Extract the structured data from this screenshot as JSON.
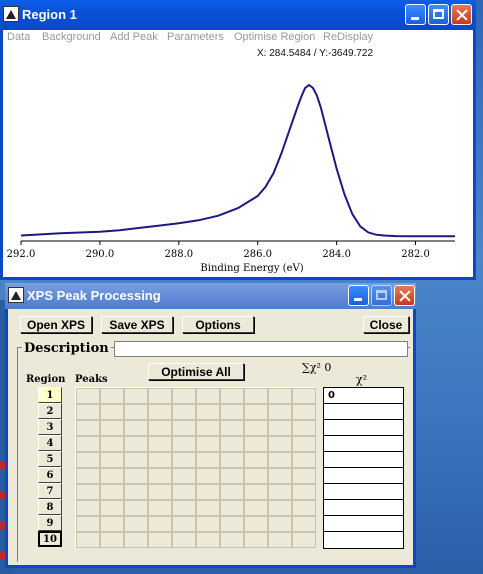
{
  "region_window": {
    "title": "Region 1",
    "menu": [
      "Data",
      "Background",
      "Add Peak",
      "Parameters",
      "Optimise Region",
      "ReDisplay"
    ],
    "coord_readout": "X: 284.5484 / Y:-3649.722",
    "icons": [
      "app-icon",
      "minimize-icon",
      "maximize-icon",
      "close-icon"
    ]
  },
  "chart_data": {
    "type": "line",
    "xlabel": "Binding Energy (eV)",
    "ylabel": "",
    "x_ticks": [
      "292.0",
      "290.0",
      "288.0",
      "286.0",
      "284.0",
      "282.0"
    ],
    "x_reversed": true,
    "xlim": [
      292.0,
      281.0
    ],
    "ylim": [
      0,
      1
    ],
    "line_color": "#1a1a80",
    "series": [
      {
        "x": [
          292.0,
          291.0,
          290.0,
          289.5,
          289.0,
          288.5,
          288.0,
          287.5,
          287.0,
          286.5,
          286.0,
          285.8,
          285.6,
          285.4,
          285.2,
          285.0,
          284.9,
          284.8,
          284.7,
          284.6,
          284.5,
          284.4,
          284.2,
          284.0,
          283.8,
          283.6,
          283.4,
          283.2,
          283.0,
          282.8,
          282.5,
          282.0,
          281.5,
          281.0
        ],
        "y": [
          0.01,
          0.025,
          0.035,
          0.045,
          0.06,
          0.075,
          0.09,
          0.11,
          0.14,
          0.19,
          0.27,
          0.33,
          0.42,
          0.55,
          0.7,
          0.85,
          0.92,
          0.98,
          1.0,
          0.98,
          0.93,
          0.85,
          0.65,
          0.45,
          0.28,
          0.15,
          0.07,
          0.03,
          0.015,
          0.01,
          0.006,
          0.005,
          0.005,
          0.005
        ]
      }
    ]
  },
  "xps_window": {
    "title": "XPS Peak Processing",
    "buttons": {
      "open": "Open XPS",
      "save": "Save XPS",
      "options": "Options",
      "close": "Close",
      "optimise_all": "Optimise All"
    },
    "description_label": "Description",
    "description_value": "",
    "region_header": "Region",
    "peaks_header": "Peaks",
    "sum_chi_label": "∑χ² 0",
    "chi_header": "χ²",
    "regions": [
      "1",
      "2",
      "3",
      "4",
      "5",
      "6",
      "7",
      "8",
      "9",
      "10"
    ],
    "selected_region": "1",
    "chi_values": [
      "0",
      "",
      "",
      "",
      "",
      "",
      "",
      "",
      "",
      ""
    ]
  }
}
